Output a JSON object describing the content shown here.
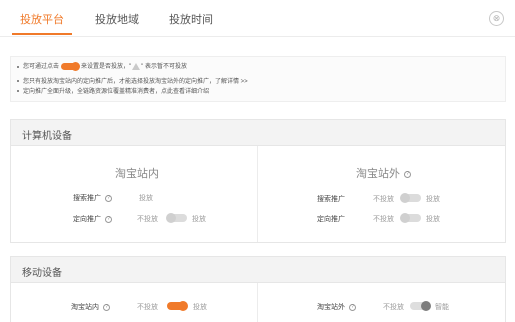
{
  "tabs": [
    {
      "label": "投放平台",
      "active": true
    },
    {
      "label": "投放地域",
      "active": false
    },
    {
      "label": "投放时间",
      "active": false
    }
  ],
  "close_icon": "⊗",
  "notices": {
    "line1_before": "您可通过点击",
    "line1_middle": "来设置是否投放，\"",
    "line1_after": "\" 表示暂不可投放",
    "line2": "您只有投放淘宝站内的定向推广后，才能选择投放淘宝站外的定向推广，了解详情 >>",
    "line3": "定向推广全面升级，全链路资源位覆盖精准消费者，点此查看详细介绍"
  },
  "computer": {
    "title": "计算机设备",
    "inside": {
      "title": "淘宝站内",
      "rows": [
        {
          "label": "搜索推广",
          "values": [
            "投放"
          ]
        },
        {
          "label": "定向推广",
          "values": [
            "不投放",
            "投放"
          ]
        }
      ]
    },
    "outside": {
      "title": "淘宝站外",
      "rows": [
        {
          "label": "搜索推广",
          "values": [
            "不投放",
            "投放"
          ]
        },
        {
          "label": "定向推广",
          "values": [
            "不投放",
            "投放"
          ]
        }
      ]
    }
  },
  "mobile": {
    "title": "移动设备",
    "inside": {
      "label": "淘宝站内",
      "values": [
        "不投放",
        "投放"
      ]
    },
    "outside": {
      "label": "淘宝站外",
      "values": [
        "不投放",
        "智能"
      ]
    }
  },
  "colors": {
    "accent": "#f07a2a",
    "muted": "#999999"
  }
}
